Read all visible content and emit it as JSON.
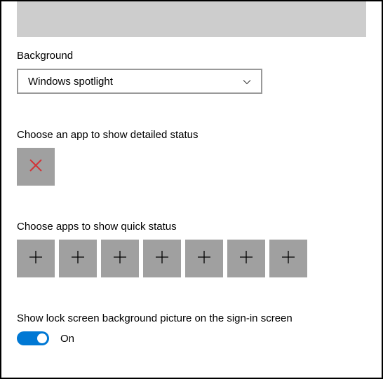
{
  "background": {
    "label": "Background",
    "selected": "Windows spotlight"
  },
  "detailed": {
    "label": "Choose an app to show detailed status"
  },
  "quick": {
    "label": "Choose apps to show quick status",
    "slots": 7
  },
  "signin": {
    "label": "Show lock screen background picture on the sign-in screen",
    "state": "On"
  }
}
